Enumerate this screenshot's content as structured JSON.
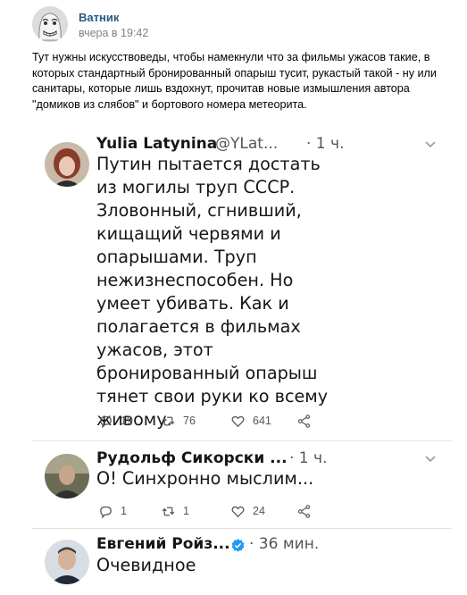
{
  "post": {
    "author": "Ватник",
    "time": "вчера в 19:42",
    "text": "Тут нужны искусствоведы, чтобы намекнули что за фильмы ужасов такие, в которых стандартный бронированный опарыш тусит, рукастый такой - ну или санитары, которые лишь вздохнут, прочитав новые измышления автора \"домиков из слябов\" и бортового номера метеорита."
  },
  "tweets": [
    {
      "name": "Yulia Latynina",
      "handle": "@YLat...",
      "time": "· 1 ч.",
      "text": "Путин пытается достать из могилы труп СССР. Зловонный, сгнивший, кищащий червями и опарышами. Труп нежизнеспособен. Но умеет убивать. Как и полагается в фильмах ужасов, этот бронированный опарыш тянет свои руки ко всему живому.",
      "replies": "19",
      "retweets": "76",
      "likes": "641"
    },
    {
      "name": "Рудольф Сикорски ...",
      "time": "· 1 ч.",
      "text": "О! Синхронно мыслим...",
      "replies": "1",
      "retweets": "1",
      "likes": "24"
    },
    {
      "name": "Евгений Ройз...",
      "time": "· 36 мин.",
      "text": "Очевидное",
      "verified": true
    }
  ],
  "icons": {
    "reply": "reply-icon",
    "retweet": "retweet-icon",
    "like": "heart-icon",
    "share": "share-icon",
    "more": "chevron-down-icon",
    "verified": "verified-badge-icon"
  },
  "colors": {
    "author_link": "#2a5885",
    "muted": "#828282",
    "verified_blue": "#1d9bf0"
  }
}
